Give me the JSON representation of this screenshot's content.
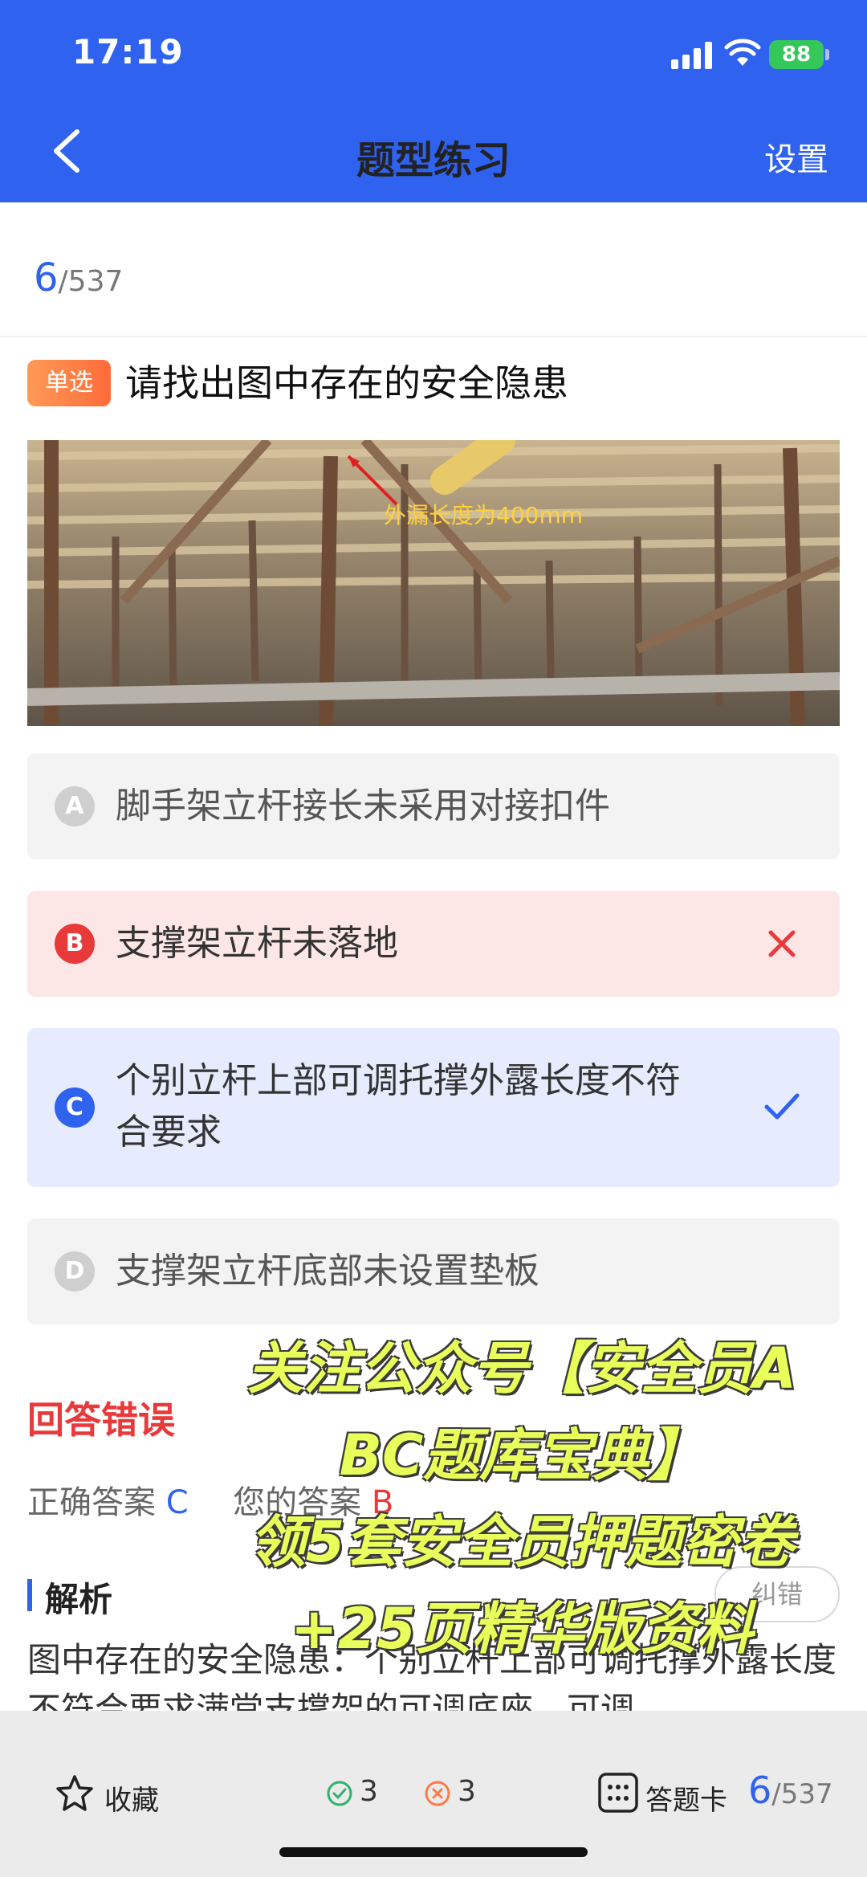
{
  "status_bar": {
    "time": "17:19",
    "battery": "88"
  },
  "header": {
    "title": "题型练习",
    "settings_label": "设置"
  },
  "progress": {
    "current": "6",
    "total": "/537"
  },
  "question": {
    "type_label": "单选",
    "text": "请找出图中存在的安全隐患",
    "image_annotation": "外漏长度为400mm"
  },
  "options": [
    {
      "letter": "A",
      "text": "脚手架立杆接长未采用对接扣件",
      "state": "normal"
    },
    {
      "letter": "B",
      "text": "支撑架立杆未落地",
      "state": "wrong"
    },
    {
      "letter": "C",
      "text_line1": "个别立杆上部可调托撑外露长度不符",
      "text_line2": "合要求",
      "state": "correct"
    },
    {
      "letter": "D",
      "text": "支撑架立杆底部未设置垫板",
      "state": "normal"
    }
  ],
  "result": {
    "title": "回答错误",
    "correct_label": "正确答案",
    "correct_value": "C",
    "yours_label": "您的答案",
    "yours_value": "B"
  },
  "analysis": {
    "title": "解析",
    "report_label": "纠错",
    "text": "图中存在的安全隐患：个别立杆上部可调托撑外露长度不符合要求满堂支撑架的可调底座、可调"
  },
  "promo": {
    "line1": "关注公众号【安全员A",
    "line2": "BC题库宝典】",
    "line3": "领5套安全员押题密卷",
    "line4": "+25页精华版资料"
  },
  "bottom_bar": {
    "favorite_label": "收藏",
    "correct_count": "3",
    "wrong_count": "3",
    "answer_card_label": "答题卡",
    "progress_current": "6",
    "progress_total": "/537"
  },
  "colors": {
    "brand": "#2f62ee",
    "wrong": "#e8393b",
    "correct_bg": "#e6ecfd",
    "wrong_bg": "#fde7e6",
    "promo": "#e9ff5a"
  }
}
